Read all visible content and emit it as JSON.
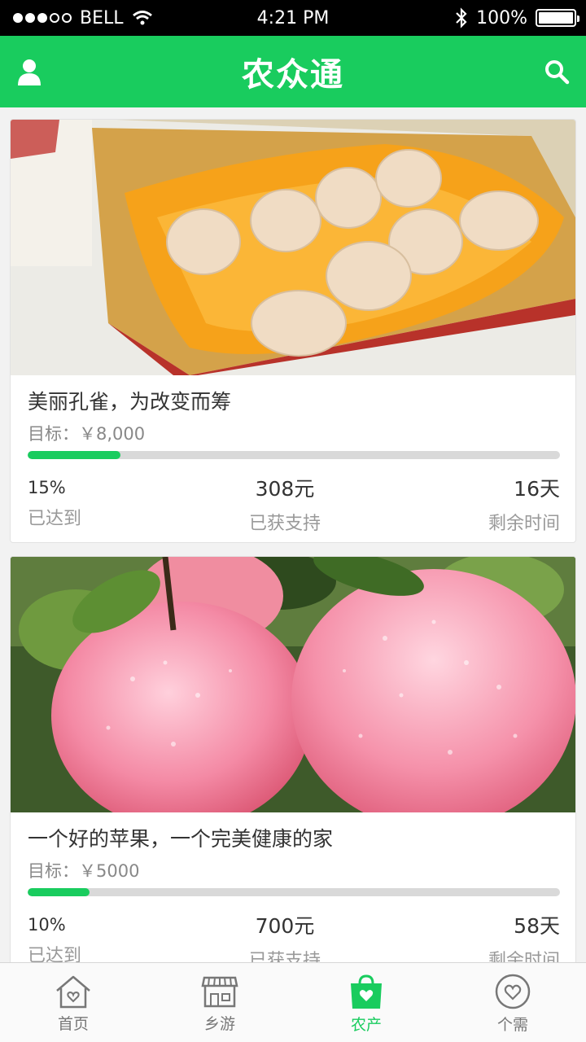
{
  "status": {
    "carrier": "BELL",
    "time": "4:21 PM",
    "battery": "100%"
  },
  "header": {
    "title": "农众通",
    "left_icon": "user-icon",
    "right_icon": "search-icon"
  },
  "projects": [
    {
      "title": "美丽孔雀，为改变而筹",
      "goal": "目标：￥8,000",
      "progress": 0.15,
      "percent": "15%",
      "percent_label": "已达到",
      "raised": "308元",
      "raised_label": "已获支持",
      "days": "16天",
      "days_label": "剩余时间"
    },
    {
      "title": "一个好的苹果，一个完美健康的家",
      "goal": "目标：￥5000",
      "progress": 0.1,
      "percent": "10%",
      "percent_label": "已达到",
      "raised": "700元",
      "raised_label": "已获支持",
      "days": "58天",
      "days_label": "剩余时间"
    }
  ],
  "tabs": [
    {
      "label": "首页",
      "icon": "home-icon"
    },
    {
      "label": "乡游",
      "icon": "store-icon"
    },
    {
      "label": "农产",
      "icon": "shopping-bag-icon"
    },
    {
      "label": "个需",
      "icon": "heart-icon"
    }
  ],
  "colors": {
    "brand": "#19cc5e",
    "inactive": "#777777"
  }
}
